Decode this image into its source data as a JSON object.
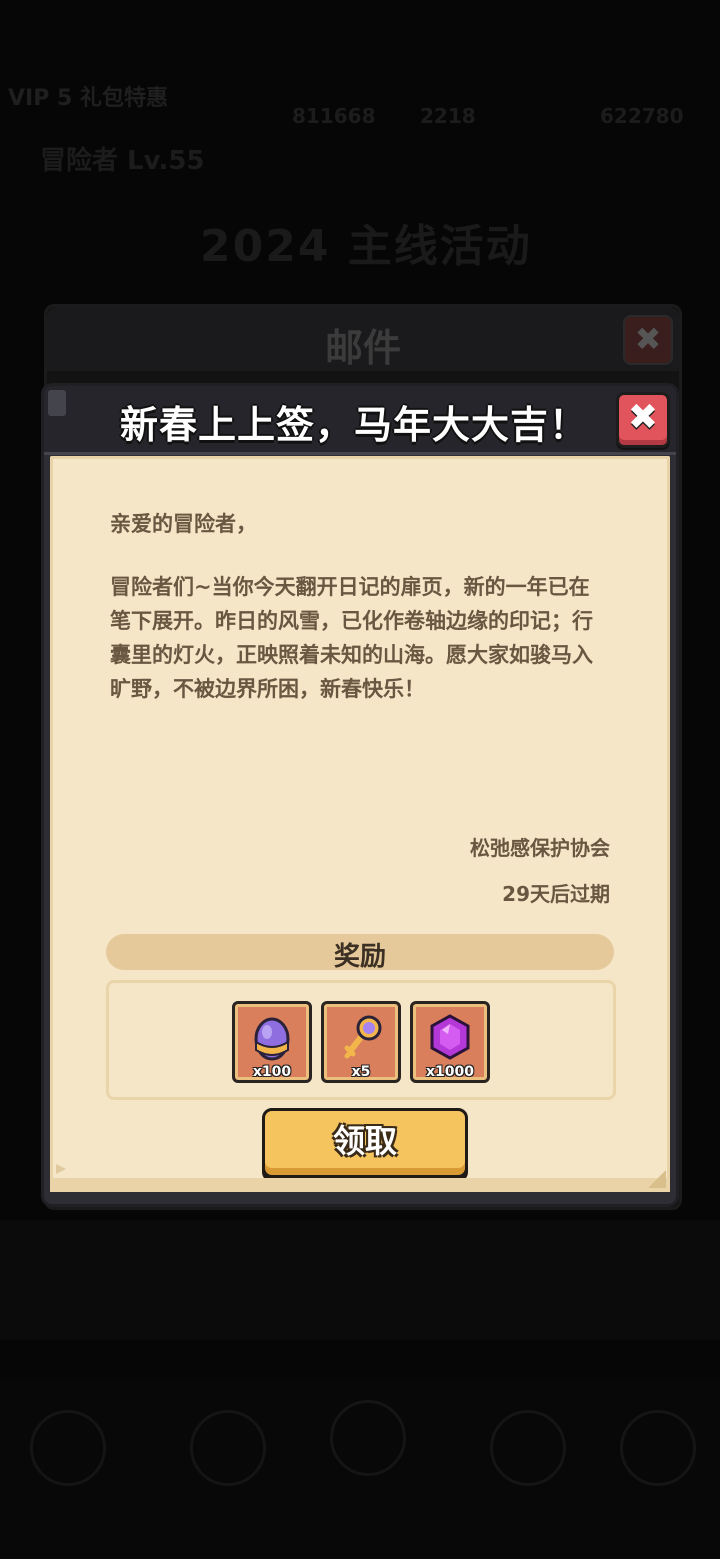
{
  "background": {
    "top_line": "VIP 5 礼包特惠",
    "resource_1": "811668",
    "resource_2": "2218",
    "resource_3": "622780",
    "line_2": "冒险者 Lv.55",
    "banner": "2024 主线活动"
  },
  "mail_panel": {
    "title": "邮件",
    "close_label": "✖"
  },
  "dialog": {
    "title": "新春上上签，马年大大吉！",
    "close_label": "✖",
    "greeting": "亲爱的冒险者，",
    "body": "冒险者们~当你今天翻开日记的扉页，新的一年已在笔下展开。昨日的风雪，已化作卷轴边缘的印记；行囊里的灯火，正映照着未知的山海。愿大家如骏马入旷野，不被边界所困，新春快乐！",
    "signature": "松弛感保护协会",
    "expiry": "29天后过期",
    "reward_label": "奖励",
    "rewards": [
      {
        "icon": "egg-icon",
        "count": "x100"
      },
      {
        "icon": "key-icon",
        "count": "x5"
      },
      {
        "icon": "gem-icon",
        "count": "x1000"
      }
    ],
    "claim_label": "领取"
  },
  "colors": {
    "paper": "#f5e6c7",
    "text": "#6a5742",
    "close_red": "#e2545c",
    "claim_yellow": "#f6c45e",
    "item_bg": "#d97f5c"
  }
}
